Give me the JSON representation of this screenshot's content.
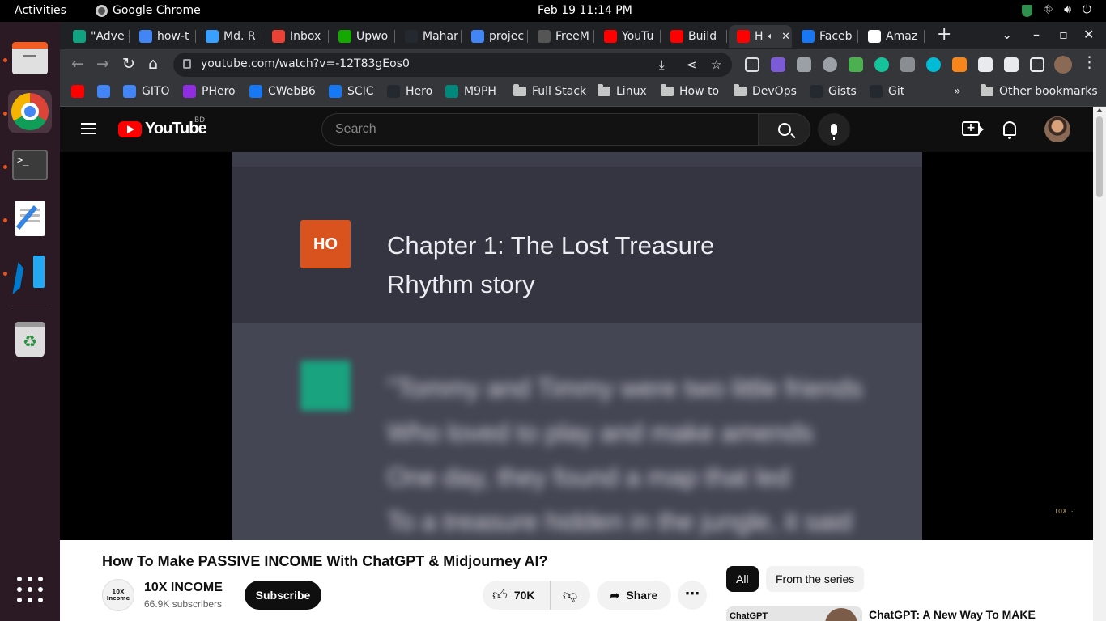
{
  "gnome": {
    "activities": "Activities",
    "app_name": "Google Chrome",
    "clock": "Feb 19  11:14 PM"
  },
  "tabs": [
    {
      "label": "\"Adve",
      "icon": "chatgpt-icon",
      "color": "#10a37f"
    },
    {
      "label": "how-t",
      "icon": "google-icon",
      "color": "#4285f4"
    },
    {
      "label": "Md. R",
      "icon": "tool-icon",
      "color": "#3aa0ff"
    },
    {
      "label": "Inbox",
      "icon": "gmail-icon",
      "color": "#ea4335"
    },
    {
      "label": "Upwo",
      "icon": "upwork-icon",
      "color": "#14a800"
    },
    {
      "label": "Mahar",
      "icon": "github-icon",
      "color": "#24292f"
    },
    {
      "label": "projec",
      "icon": "docs-icon",
      "color": "#4285f4"
    },
    {
      "label": "FreeM",
      "icon": "freem-icon",
      "color": "#555555"
    },
    {
      "label": "YouTu",
      "icon": "youtube-icon",
      "color": "#ff0000"
    },
    {
      "label": "Build",
      "icon": "youtube-icon",
      "color": "#ff0000"
    },
    {
      "label": "H",
      "icon": "youtube-icon",
      "color": "#ff0000",
      "active": true
    },
    {
      "label": "Faceb",
      "icon": "facebook-icon",
      "color": "#1877f2"
    },
    {
      "label": "Amaz",
      "icon": "amazon-icon",
      "color": "#ffffff"
    }
  ],
  "toolbar": {
    "url": "youtube.com/watch?v=-12T83gEos0"
  },
  "bookmarks": [
    {
      "label": "",
      "icon": "youtube-icon",
      "color": "#ff0000"
    },
    {
      "label": "",
      "icon": "translate-icon",
      "color": "#4285f4"
    },
    {
      "label": "GITO",
      "icon": "google-icon",
      "color": "#4285f4"
    },
    {
      "label": "PHero",
      "icon": "phero-icon",
      "color": "#8e2de2"
    },
    {
      "label": "CWebB6",
      "icon": "facebook-icon",
      "color": "#1877f2"
    },
    {
      "label": "SCIC",
      "icon": "facebook-icon",
      "color": "#1877f2"
    },
    {
      "label": "Hero",
      "icon": "github-icon",
      "color": "#24292f"
    },
    {
      "label": "M9PH",
      "icon": "meet-icon",
      "color": "#00897b"
    },
    {
      "label": "Full Stack",
      "icon": "folder-icon"
    },
    {
      "label": "Linux",
      "icon": "folder-icon"
    },
    {
      "label": "How to",
      "icon": "folder-icon"
    },
    {
      "label": "DevOps",
      "icon": "folder-icon"
    },
    {
      "label": "Gists",
      "icon": "github-icon",
      "color": "#24292f"
    },
    {
      "label": "Git",
      "icon": "github-icon",
      "color": "#24292f"
    }
  ],
  "bookmarks_more": "»",
  "other_bookmarks": "Other bookmarks",
  "youtube": {
    "logo_text": "YouTube",
    "country": "BD",
    "search_placeholder": "Search"
  },
  "video": {
    "badge": "HO",
    "chapter_line1": "Chapter 1: The Lost Treasure",
    "chapter_line2": "Rhythm story",
    "blurred_lines": [
      "\"Tommy and Timmy were two little friends",
      "Who loved to play and make amends",
      "One day, they found a map that led",
      "To a treasure hidden in the jungle, it said"
    ]
  },
  "details": {
    "title": "How To Make PASSIVE INCOME With ChatGPT & Midjourney AI?",
    "channel": "10X INCOME",
    "channel_avatar": "10X Income",
    "subscribers": "66.9K subscribers",
    "subscribe": "Subscribe",
    "likes": "70K",
    "share": "Share",
    "more": "⋯"
  },
  "sidebar": {
    "chip_all": "All",
    "chip_series": "From the series",
    "rec_thumb_label": "ChatGPT",
    "rec_title": "ChatGPT: A New Way To MAKE"
  }
}
